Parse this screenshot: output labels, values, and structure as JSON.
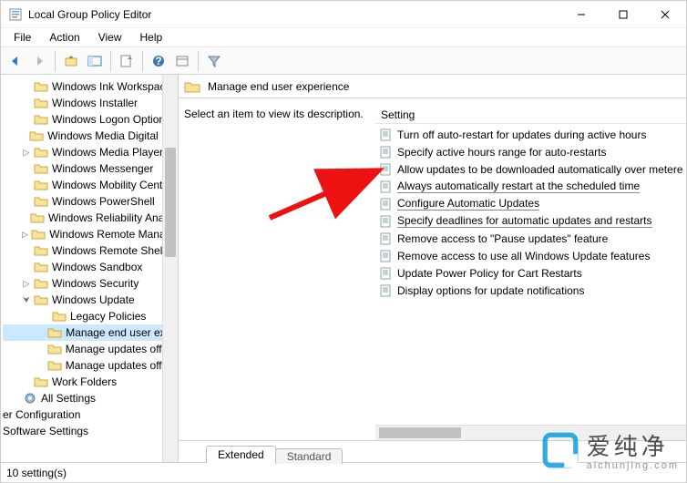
{
  "window": {
    "title": "Local Group Policy Editor"
  },
  "menu": {
    "file": "File",
    "action": "Action",
    "view": "View",
    "help": "Help"
  },
  "header": {
    "title": "Manage end user experience"
  },
  "description": "Select an item to view its description.",
  "column": {
    "setting": "Setting"
  },
  "tabs": {
    "extended": "Extended",
    "standard": "Standard"
  },
  "status": "10 setting(s)",
  "tree": {
    "n0": "Windows Ink Workspace",
    "n1": "Windows Installer",
    "n2": "Windows Logon Options",
    "n3": "Windows Media Digital Rig",
    "n4": "Windows Media Player",
    "n5": "Windows Messenger",
    "n6": "Windows Mobility Center",
    "n7": "Windows PowerShell",
    "n8": "Windows Reliability Analys",
    "n9": "Windows Remote Manage",
    "n10": "Windows Remote Shell",
    "n11": "Windows Sandbox",
    "n12": "Windows Security",
    "n13": "Windows Update",
    "n14": "Legacy Policies",
    "n15": "Manage end user expe",
    "n16": "Manage updates offere",
    "n17": "Manage updates offere",
    "n18": "Work Folders",
    "n19": "All Settings",
    "n20": "er Configuration",
    "n21": "Software Settings"
  },
  "items": {
    "i0": "Turn off auto-restart for updates during active hours",
    "i1": "Specify active hours range for auto-restarts",
    "i2": "Allow updates to be downloaded automatically over metere",
    "i3": "Always automatically restart at the scheduled time",
    "i4": "Configure Automatic Updates",
    "i5": "Specify deadlines for automatic updates and restarts",
    "i6": "Remove access to \"Pause updates\" feature",
    "i7": "Remove access to use all Windows Update features",
    "i8": "Update Power Policy for Cart Restarts",
    "i9": "Display options for update notifications"
  },
  "watermark": {
    "text": "爱纯净",
    "sub": "aichunjing.com"
  }
}
